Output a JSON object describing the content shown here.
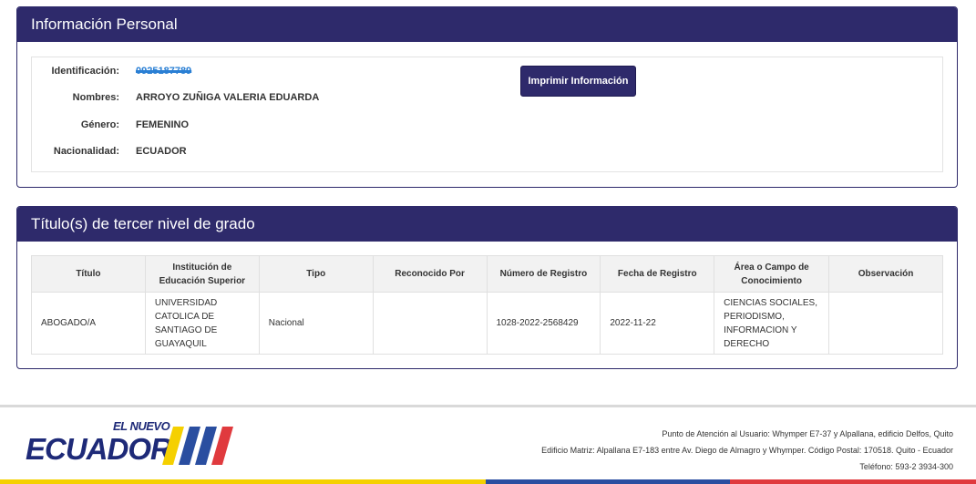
{
  "personal": {
    "title": "Información Personal",
    "fields": [
      {
        "label": "Identificación:",
        "value": "0925187789"
      },
      {
        "label": "Nombres:",
        "value": "ARROYO ZUÑIGA VALERIA EDUARDA"
      },
      {
        "label": "Género:",
        "value": "FEMENINO"
      },
      {
        "label": "Nacionalidad:",
        "value": "ECUADOR"
      }
    ],
    "print_button": "Imprimir Información"
  },
  "titles": {
    "title": "Título(s) de tercer nivel de grado",
    "columns": [
      "Título",
      "Institución de Educación Superior",
      "Tipo",
      "Reconocido Por",
      "Número de Registro",
      "Fecha de Registro",
      "Área o Campo de Conocimiento",
      "Observación"
    ],
    "rows": [
      [
        "ABOGADO/A",
        "UNIVERSIDAD CATOLICA DE SANTIAGO DE GUAYAQUIL",
        "Nacional",
        "",
        "1028-2022-2568429",
        "2022-11-22",
        "CIENCIAS SOCIALES, PERIODISMO, INFORMACION Y DERECHO",
        ""
      ]
    ]
  },
  "footer": {
    "logo_top": "EL NUEVO",
    "logo_main": "ECUADOR",
    "lines": [
      "Punto de Atención al Usuario: Whymper E7-37 y Alpallana, edificio Delfos, Quito",
      "Edificio Matriz: Alpallana E7-183 entre Av. Diego de Almagro y Whymper. Código Postal: 170518. Quito - Ecuador",
      "Teléfono: 593-2 3934-300"
    ]
  },
  "colors": {
    "header": "#2e2a6b",
    "flag_yellow": "#f5d000",
    "flag_blue": "#2a4ea0",
    "flag_red": "#e03a3e"
  }
}
